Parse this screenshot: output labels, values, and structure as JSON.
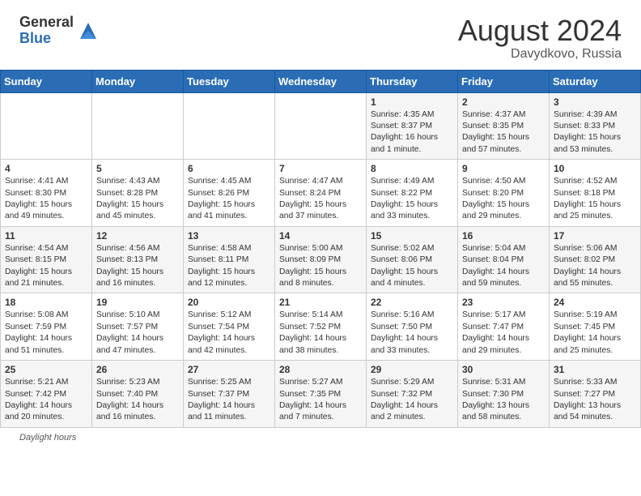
{
  "header": {
    "logo_general": "General",
    "logo_blue": "Blue",
    "month_year": "August 2024",
    "location": "Davydkovo, Russia"
  },
  "footer": {
    "daylight_label": "Daylight hours"
  },
  "weekdays": [
    "Sunday",
    "Monday",
    "Tuesday",
    "Wednesday",
    "Thursday",
    "Friday",
    "Saturday"
  ],
  "weeks": [
    [
      {
        "num": "",
        "info": ""
      },
      {
        "num": "",
        "info": ""
      },
      {
        "num": "",
        "info": ""
      },
      {
        "num": "",
        "info": ""
      },
      {
        "num": "1",
        "info": "Sunrise: 4:35 AM\nSunset: 8:37 PM\nDaylight: 16 hours and 1 minute."
      },
      {
        "num": "2",
        "info": "Sunrise: 4:37 AM\nSunset: 8:35 PM\nDaylight: 15 hours and 57 minutes."
      },
      {
        "num": "3",
        "info": "Sunrise: 4:39 AM\nSunset: 8:33 PM\nDaylight: 15 hours and 53 minutes."
      }
    ],
    [
      {
        "num": "4",
        "info": "Sunrise: 4:41 AM\nSunset: 8:30 PM\nDaylight: 15 hours and 49 minutes."
      },
      {
        "num": "5",
        "info": "Sunrise: 4:43 AM\nSunset: 8:28 PM\nDaylight: 15 hours and 45 minutes."
      },
      {
        "num": "6",
        "info": "Sunrise: 4:45 AM\nSunset: 8:26 PM\nDaylight: 15 hours and 41 minutes."
      },
      {
        "num": "7",
        "info": "Sunrise: 4:47 AM\nSunset: 8:24 PM\nDaylight: 15 hours and 37 minutes."
      },
      {
        "num": "8",
        "info": "Sunrise: 4:49 AM\nSunset: 8:22 PM\nDaylight: 15 hours and 33 minutes."
      },
      {
        "num": "9",
        "info": "Sunrise: 4:50 AM\nSunset: 8:20 PM\nDaylight: 15 hours and 29 minutes."
      },
      {
        "num": "10",
        "info": "Sunrise: 4:52 AM\nSunset: 8:18 PM\nDaylight: 15 hours and 25 minutes."
      }
    ],
    [
      {
        "num": "11",
        "info": "Sunrise: 4:54 AM\nSunset: 8:15 PM\nDaylight: 15 hours and 21 minutes."
      },
      {
        "num": "12",
        "info": "Sunrise: 4:56 AM\nSunset: 8:13 PM\nDaylight: 15 hours and 16 minutes."
      },
      {
        "num": "13",
        "info": "Sunrise: 4:58 AM\nSunset: 8:11 PM\nDaylight: 15 hours and 12 minutes."
      },
      {
        "num": "14",
        "info": "Sunrise: 5:00 AM\nSunset: 8:09 PM\nDaylight: 15 hours and 8 minutes."
      },
      {
        "num": "15",
        "info": "Sunrise: 5:02 AM\nSunset: 8:06 PM\nDaylight: 15 hours and 4 minutes."
      },
      {
        "num": "16",
        "info": "Sunrise: 5:04 AM\nSunset: 8:04 PM\nDaylight: 14 hours and 59 minutes."
      },
      {
        "num": "17",
        "info": "Sunrise: 5:06 AM\nSunset: 8:02 PM\nDaylight: 14 hours and 55 minutes."
      }
    ],
    [
      {
        "num": "18",
        "info": "Sunrise: 5:08 AM\nSunset: 7:59 PM\nDaylight: 14 hours and 51 minutes."
      },
      {
        "num": "19",
        "info": "Sunrise: 5:10 AM\nSunset: 7:57 PM\nDaylight: 14 hours and 47 minutes."
      },
      {
        "num": "20",
        "info": "Sunrise: 5:12 AM\nSunset: 7:54 PM\nDaylight: 14 hours and 42 minutes."
      },
      {
        "num": "21",
        "info": "Sunrise: 5:14 AM\nSunset: 7:52 PM\nDaylight: 14 hours and 38 minutes."
      },
      {
        "num": "22",
        "info": "Sunrise: 5:16 AM\nSunset: 7:50 PM\nDaylight: 14 hours and 33 minutes."
      },
      {
        "num": "23",
        "info": "Sunrise: 5:17 AM\nSunset: 7:47 PM\nDaylight: 14 hours and 29 minutes."
      },
      {
        "num": "24",
        "info": "Sunrise: 5:19 AM\nSunset: 7:45 PM\nDaylight: 14 hours and 25 minutes."
      }
    ],
    [
      {
        "num": "25",
        "info": "Sunrise: 5:21 AM\nSunset: 7:42 PM\nDaylight: 14 hours and 20 minutes."
      },
      {
        "num": "26",
        "info": "Sunrise: 5:23 AM\nSunset: 7:40 PM\nDaylight: 14 hours and 16 minutes."
      },
      {
        "num": "27",
        "info": "Sunrise: 5:25 AM\nSunset: 7:37 PM\nDaylight: 14 hours and 11 minutes."
      },
      {
        "num": "28",
        "info": "Sunrise: 5:27 AM\nSunset: 7:35 PM\nDaylight: 14 hours and 7 minutes."
      },
      {
        "num": "29",
        "info": "Sunrise: 5:29 AM\nSunset: 7:32 PM\nDaylight: 14 hours and 2 minutes."
      },
      {
        "num": "30",
        "info": "Sunrise: 5:31 AM\nSunset: 7:30 PM\nDaylight: 13 hours and 58 minutes."
      },
      {
        "num": "31",
        "info": "Sunrise: 5:33 AM\nSunset: 7:27 PM\nDaylight: 13 hours and 54 minutes."
      }
    ]
  ]
}
